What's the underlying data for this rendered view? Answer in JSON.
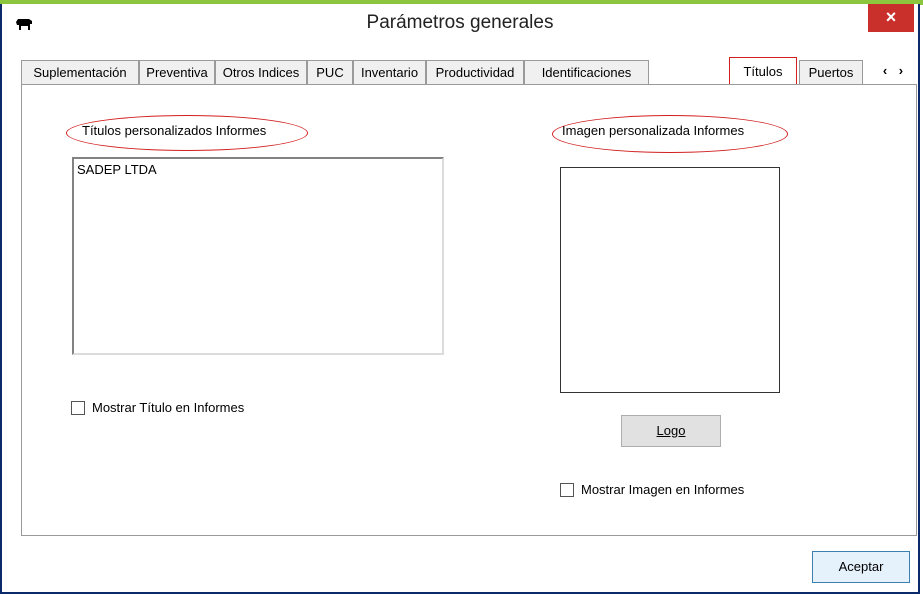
{
  "window": {
    "title": "Parámetros generales",
    "close_label": "×",
    "app_icon": "cow-icon"
  },
  "tabs": [
    {
      "label": "Suplementación"
    },
    {
      "label": "Preventiva"
    },
    {
      "label": "Otros Indices"
    },
    {
      "label": "PUC"
    },
    {
      "label": "Inventario"
    },
    {
      "label": "Productividad"
    },
    {
      "label": "Identificaciones"
    },
    {
      "label": "Títulos",
      "active": true
    },
    {
      "label": "Puertos"
    }
  ],
  "tab_scroll_label": "‹ ›",
  "titulos": {
    "section_label": "Títulos personalizados Informes",
    "textarea_value": "SADEP LTDA",
    "checkbox_label": "Mostrar Título en Informes",
    "checkbox_checked": false
  },
  "imagen": {
    "section_label": "Imagen personalizada Informes",
    "logo_button": "Logo",
    "checkbox_label": "Mostrar Imagen en Informes",
    "checkbox_checked": false
  },
  "footer": {
    "ok_button": "Aceptar"
  },
  "colors": {
    "highlight": "#d21f1f",
    "frame": "#0a2a6b",
    "close": "#c9302c"
  }
}
